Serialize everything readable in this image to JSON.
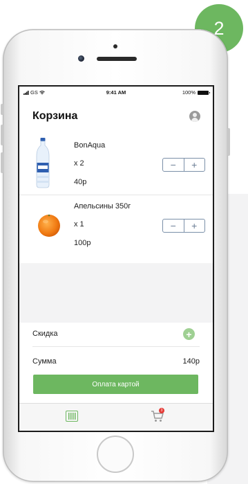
{
  "step_badge": "2",
  "status_bar": {
    "carrier": "GS",
    "time": "9:41 AM",
    "battery": "100%"
  },
  "header": {
    "title": "Корзина",
    "profile_icon": "user-icon"
  },
  "cart": {
    "items": [
      {
        "name": "BonAqua",
        "quantity": "x 2",
        "price": "40р",
        "image": "water-bottle-image"
      },
      {
        "name": "Апельсины 350г",
        "quantity": "x 1",
        "price": "100р",
        "image": "orange-image"
      }
    ],
    "stepper": {
      "minus": "−",
      "plus": "+"
    }
  },
  "discount": {
    "label": "Скидка",
    "add_icon": "plus-icon",
    "add_symbol": "+"
  },
  "total": {
    "label": "Сумма",
    "value": "140р"
  },
  "pay_button": "Оплата картой",
  "tab_bar": {
    "items": [
      {
        "icon": "barcode-icon",
        "active": true
      },
      {
        "icon": "cart-icon",
        "badge": "3"
      }
    ]
  },
  "colors": {
    "accent": "#6db760",
    "stepper_border": "#7a8fa8",
    "badge_red": "#e53935"
  }
}
